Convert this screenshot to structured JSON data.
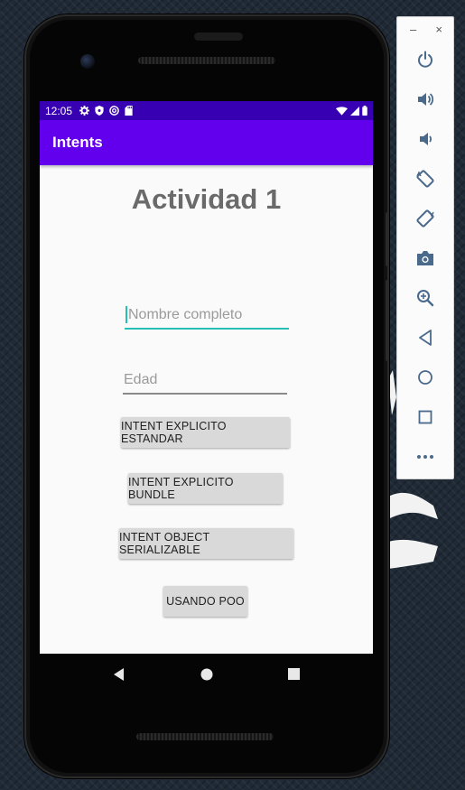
{
  "status_bar": {
    "time": "12:05"
  },
  "app_bar": {
    "title": "Intents"
  },
  "main": {
    "heading": "Actividad 1",
    "name_field": {
      "placeholder": "Nombre completo",
      "value": ""
    },
    "age_field": {
      "placeholder": "Edad",
      "value": ""
    },
    "buttons": [
      {
        "label": "INTENT EXPLICITO ESTANDAR"
      },
      {
        "label": "INTENT EXPLICITO BUNDLE"
      },
      {
        "label": "INTENT OBJECT SERIALIZABLE"
      },
      {
        "label": "USANDO POO"
      }
    ]
  },
  "nav_bar": {
    "icons": [
      "back-icon",
      "home-icon",
      "recents-icon"
    ]
  },
  "emulator_toolbar": {
    "minimize_label": "–",
    "close_label": "×",
    "icons": [
      "power-icon",
      "volume-up-icon",
      "volume-down-icon",
      "rotate-left-icon",
      "rotate-right-icon",
      "camera-icon",
      "zoom-icon",
      "back-icon",
      "home-icon",
      "overview-icon",
      "more-icon"
    ]
  },
  "colors": {
    "status_bar": "#3700b3",
    "app_bar": "#6200ee",
    "accent": "#26bfb5",
    "toolbar_icon": "#4a6a8c"
  }
}
